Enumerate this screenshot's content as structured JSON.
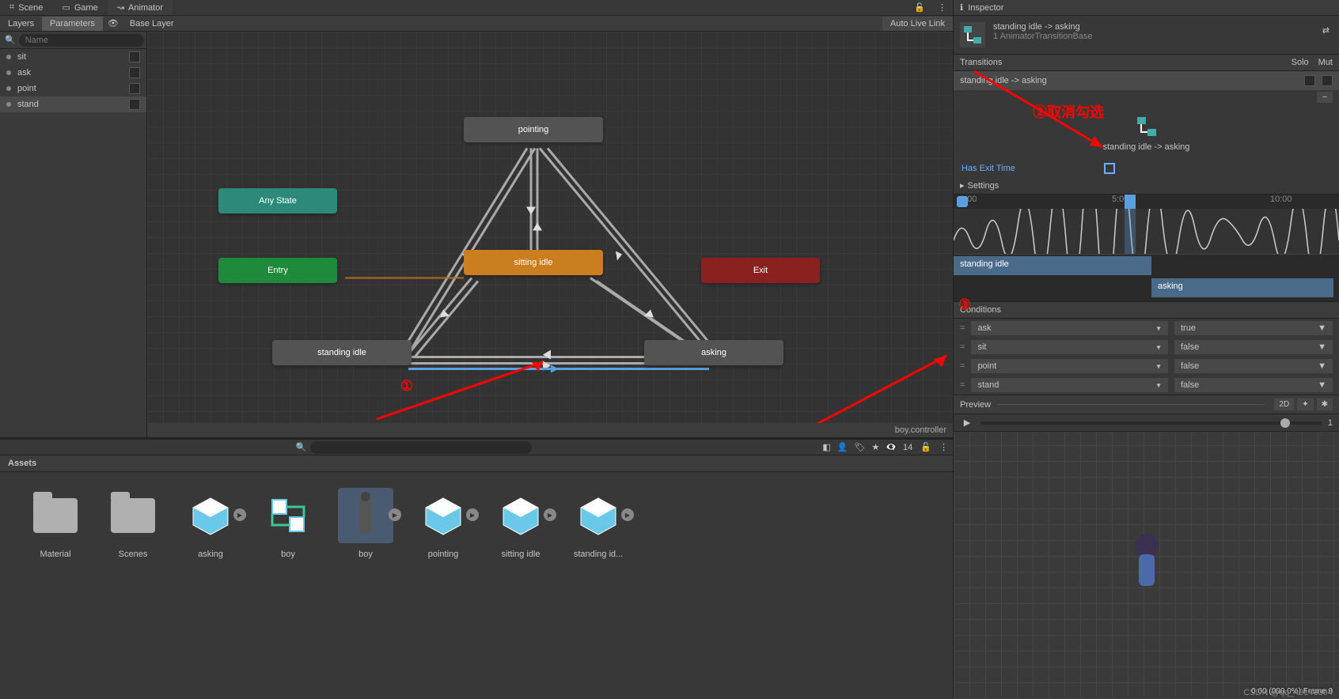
{
  "tabs": {
    "scene": "Scene",
    "game": "Game",
    "animator": "Animator",
    "inspector": "Inspector"
  },
  "toolbar": {
    "layers": "Layers",
    "parameters": "Parameters",
    "breadcrumb": "Base Layer",
    "autolive": "Auto Live Link"
  },
  "paramSearch": {
    "placeholder": "Name"
  },
  "params": [
    {
      "name": "sit"
    },
    {
      "name": "ask"
    },
    {
      "name": "point"
    },
    {
      "name": "stand"
    }
  ],
  "nodes": {
    "pointing": "pointing",
    "sitting": "sitting idle",
    "standing": "standing idle",
    "asking": "asking",
    "any": "Any State",
    "entry": "Entry",
    "exit": "Exit"
  },
  "graphFooter": "boy.controller",
  "project": {
    "header": "Assets",
    "count": "14",
    "items": [
      {
        "name": "Material",
        "type": "folder"
      },
      {
        "name": "Scenes",
        "type": "folder"
      },
      {
        "name": "asking",
        "type": "anim"
      },
      {
        "name": "boy",
        "type": "controller"
      },
      {
        "name": "boy",
        "type": "prefab",
        "selected": true
      },
      {
        "name": "pointing",
        "type": "anim"
      },
      {
        "name": "sitting idle",
        "type": "anim"
      },
      {
        "name": "standing id...",
        "type": "anim"
      }
    ]
  },
  "inspector": {
    "title1": "standing idle -> asking",
    "title2": "1 AnimatorTransitionBase",
    "transHeader": "Transitions",
    "solo": "Solo",
    "mute": "Mut",
    "transRow": "standing idle -> asking",
    "transDetail": "standing idle -> asking",
    "hasExit": "Has Exit Time",
    "settings": "Settings",
    "tl": {
      "t0": "0:00",
      "t5": "5:00",
      "t10": "10:00"
    },
    "blendA": "standing idle",
    "blendB": "asking",
    "condHeader": "Conditions",
    "conditions": [
      {
        "param": "ask",
        "val": "true"
      },
      {
        "param": "sit",
        "val": "false"
      },
      {
        "param": "point",
        "val": "false"
      },
      {
        "param": "stand",
        "val": "false"
      }
    ],
    "preview": "Preview",
    "pv2d": "2D",
    "pvFooter": "0:00 (000.0%) Frame 0"
  },
  "annotations": {
    "a1": "①",
    "a2": "②取消勾选",
    "a3": "③"
  },
  "watermark": "CSDN @qq_49149394"
}
